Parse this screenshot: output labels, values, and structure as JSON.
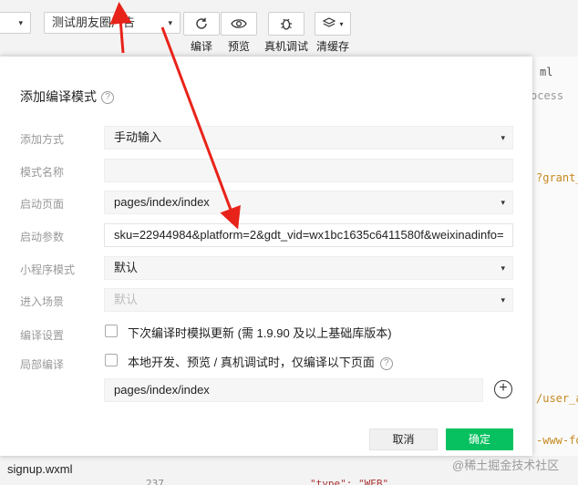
{
  "toolbar": {
    "left_select_caret": "▾",
    "compile_mode_value": "测试朋友圈广告",
    "compile_label": "编译",
    "preview_label": "预览",
    "debug_label": "真机调试",
    "cache_label": "清缓存"
  },
  "background": {
    "tab_fragment": "ml",
    "breadcrumb_fragment": "ocess",
    "code_grant": "?grant_",
    "code_user": "/user_a",
    "code_www": "-www-fo",
    "bottom_file": "signup.wxml",
    "bottom_line_num": "237",
    "bottom_code": "\"type\": \"WEB\""
  },
  "dialog": {
    "title": "添加编译模式",
    "rows": {
      "add_method_label": "添加方式",
      "add_method_value": "手动输入",
      "mode_name_label": "模式名称",
      "mode_name_value": "",
      "start_page_label": "启动页面",
      "start_page_value": "pages/index/index",
      "start_params_label": "启动参数",
      "start_params_value": "sku=22944984&platform=2&gdt_vid=wx1bc1635c6411580f&weixinadinfo=",
      "mp_mode_label": "小程序模式",
      "mp_mode_value": "默认",
      "scene_label": "进入场景",
      "scene_placeholder": "默认",
      "compile_settings_label": "编译设置",
      "compile_settings_text": "下次编译时模拟更新 (需 1.9.90 及以上基础库版本)",
      "partial_compile_label": "局部编译",
      "partial_compile_text": "本地开发、预览 / 真机调试时，仅编译以下页面",
      "partial_page_value": "pages/index/index"
    },
    "cancel_label": "取消",
    "ok_label": "确定"
  },
  "watermark": "@稀土掘金技术社区",
  "colors": {
    "accent_green": "#07c160",
    "arrow_red": "#e8231a"
  }
}
